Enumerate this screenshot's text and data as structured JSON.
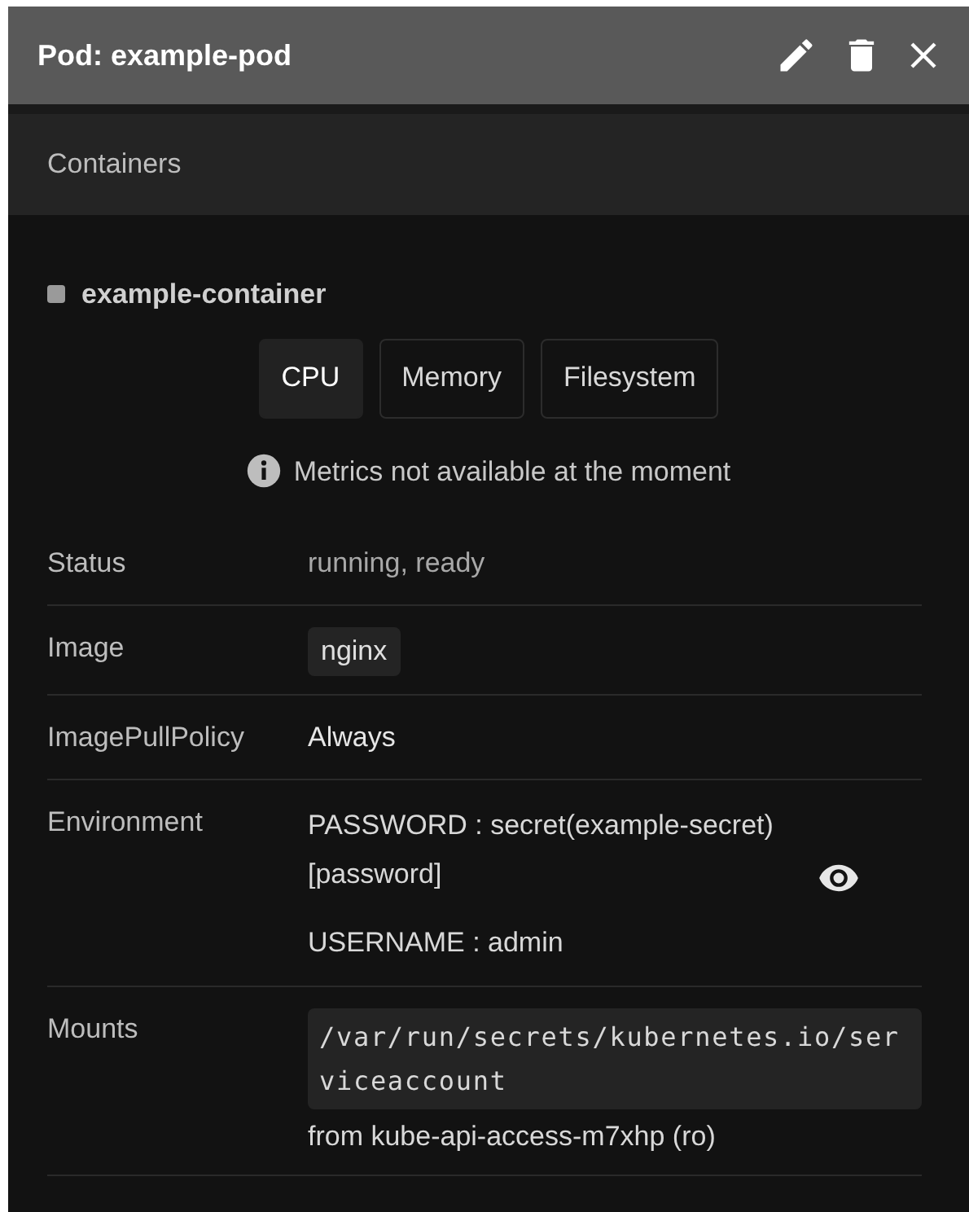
{
  "window": {
    "title": "Pod: example-pod"
  },
  "section": {
    "title": "Containers"
  },
  "container": {
    "name": "example-container",
    "metric_tabs": [
      {
        "label": "CPU",
        "selected": true
      },
      {
        "label": "Memory",
        "selected": false
      },
      {
        "label": "Filesystem",
        "selected": false
      }
    ],
    "notice": "Metrics not available at the moment",
    "rows": [
      {
        "kind": "text",
        "label": "Status",
        "value": "running, ready",
        "muted": true
      },
      {
        "kind": "chip",
        "label": "Image",
        "value": "nginx"
      },
      {
        "kind": "text",
        "label": "ImagePullPolicy",
        "value": "Always",
        "muted": false
      },
      {
        "kind": "env",
        "label": "Environment",
        "vars": [
          {
            "text": "PASSWORD : secret(example-secret) [password]",
            "secret": true
          },
          {
            "text": "USERNAME : admin",
            "secret": false
          }
        ]
      },
      {
        "kind": "mounts",
        "label": "Mounts",
        "mounts": [
          {
            "path": "/var/run/secrets/kubernetes.io/serviceaccount",
            "source": "from kube-api-access-m7xhp (ro)"
          }
        ]
      }
    ]
  }
}
